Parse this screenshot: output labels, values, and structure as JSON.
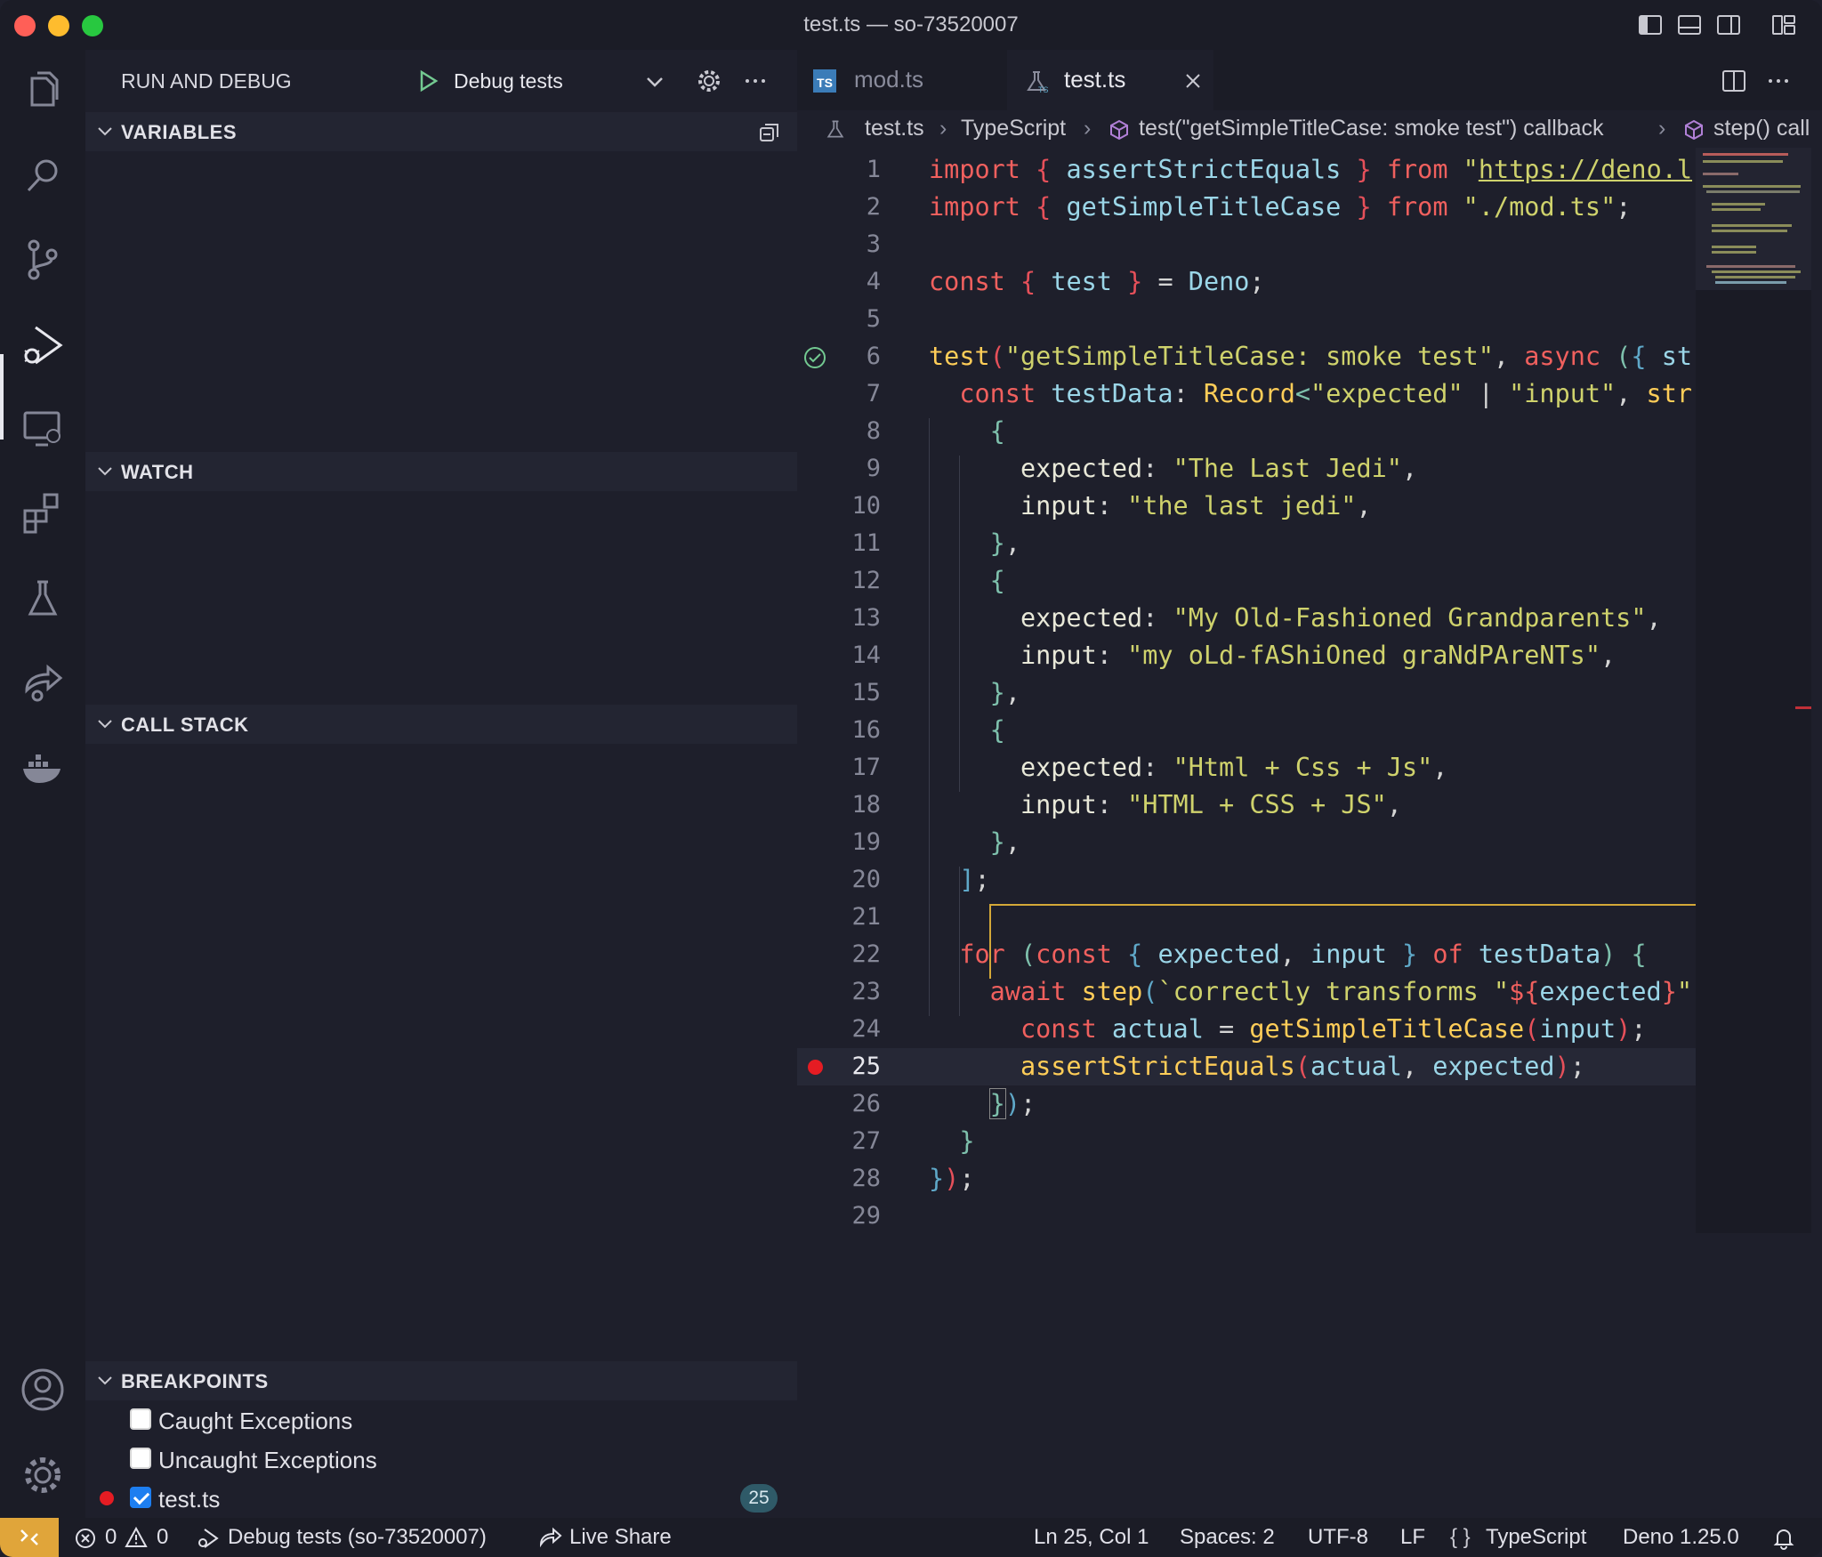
{
  "window": {
    "title": "test.ts — so-73520007"
  },
  "sidebar": {
    "header": "RUN AND DEBUG",
    "config_name": "Debug tests",
    "sections": {
      "variables": "VARIABLES",
      "watch": "WATCH",
      "call_stack": "CALL STACK",
      "breakpoints": "BREAKPOINTS"
    },
    "breakpoints": [
      {
        "label": "Caught Exceptions",
        "checked": false
      },
      {
        "label": "Uncaught Exceptions",
        "checked": false
      },
      {
        "label": "test.ts",
        "checked": true,
        "badge": "25"
      }
    ]
  },
  "tabs": [
    {
      "label": "mod.ts",
      "icon": "typescript-file-icon",
      "active": false
    },
    {
      "label": "test.ts",
      "icon": "test-file-icon",
      "active": true
    }
  ],
  "breadcrumb": [
    "test.ts",
    "TypeScript",
    "test(\"getSimpleTitleCase: smoke test\") callback",
    "step() call"
  ],
  "editor": {
    "current_line": 25,
    "breakpoint_line": 25,
    "test_passed_line": 6,
    "lines": [
      "import { assertStrictEquals } from \"https://deno.l",
      "import { getSimpleTitleCase } from \"./mod.ts\";",
      "",
      "const { test } = Deno;",
      "",
      "test(\"getSimpleTitleCase: smoke test\", async ({ st",
      "  const testData: Record<\"expected\" | \"input\", str",
      "    {",
      "      expected: \"The Last Jedi\",",
      "      input: \"the last jedi\",",
      "    },",
      "    {",
      "      expected: \"My Old-Fashioned Grandparents\",",
      "      input: \"my oLd-fAShiOned graNdPAreNTs\",",
      "    },",
      "    {",
      "      expected: \"Html + Css + Js\",",
      "      input: \"HTML + CSS + JS\",",
      "    },",
      "  ];",
      "",
      "  for (const { expected, input } of testData) {",
      "    await step(`correctly transforms \"${expected}\"",
      "      const actual = getSimpleTitleCase(input);",
      "      assertStrictEquals(actual, expected);",
      "    });",
      "  }",
      "});",
      ""
    ]
  },
  "status": {
    "errors": "0",
    "warnings": "0",
    "debug": "Debug tests (so-73520007)",
    "live_share": "Live Share",
    "position": "Ln 25, Col 1",
    "spaces": "Spaces: 2",
    "encoding": "UTF-8",
    "eol": "LF",
    "language": "TypeScript",
    "runtime": "Deno 1.25.0"
  },
  "colors": {
    "accent": "#e0a53a",
    "run": "#73c991",
    "breakpoint": "#e51c23",
    "keyword": "#f0605e",
    "string": "#cfd26c"
  }
}
